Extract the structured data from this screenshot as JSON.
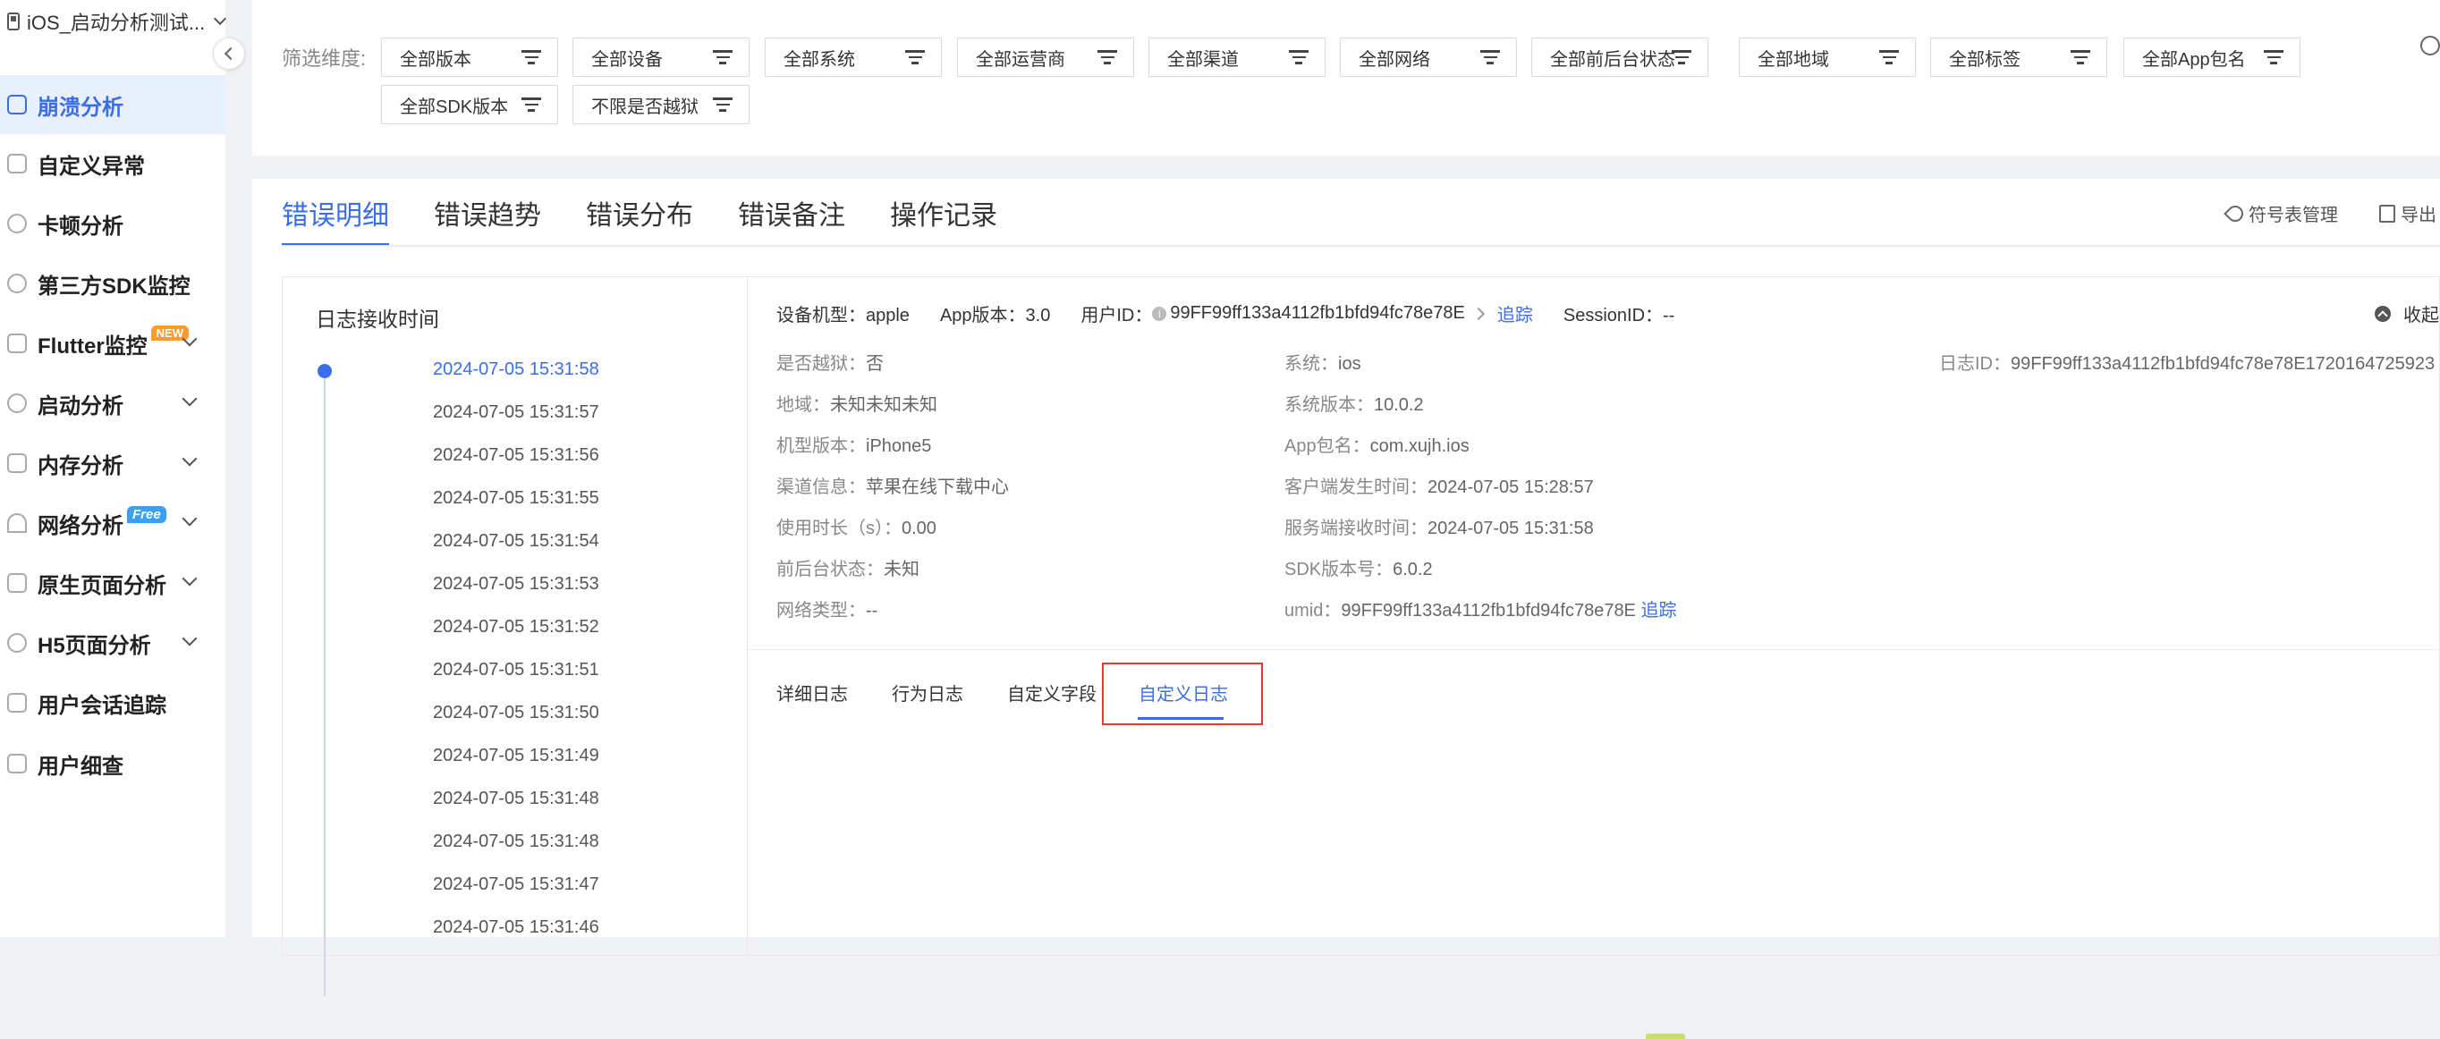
{
  "app": {
    "name": "iOS_启动分析测试..."
  },
  "sidebar": {
    "items": [
      {
        "label": "崩溃分析",
        "icon": "doc-icon"
      },
      {
        "label": "自定义异常",
        "icon": "chart-icon"
      },
      {
        "label": "卡顿分析",
        "icon": "clock-icon"
      },
      {
        "label": "第三方SDK监控",
        "icon": "user-icon"
      },
      {
        "label": "Flutter监控",
        "icon": "flutter-icon",
        "badge": "NEW"
      },
      {
        "label": "启动分析",
        "icon": "launch-icon"
      },
      {
        "label": "内存分析",
        "icon": "memory-icon"
      },
      {
        "label": "网络分析",
        "icon": "wifi-icon",
        "badge": "Free"
      },
      {
        "label": "原生页面分析",
        "icon": "page-icon"
      },
      {
        "label": "H5页面分析",
        "icon": "h5-icon"
      },
      {
        "label": "用户会话追踪",
        "icon": "session-icon"
      },
      {
        "label": "用户细查",
        "icon": "detail-icon"
      }
    ]
  },
  "filters": {
    "label": "筛选维度:",
    "items": [
      "全部版本",
      "全部设备",
      "全部系统",
      "全部运营商",
      "全部渠道",
      "全部网络",
      "全部前后台状态",
      "全部地域",
      "全部标签",
      "全部App包名",
      "全部SDK版本",
      "不限是否越狱"
    ]
  },
  "tabs": [
    "错误明细",
    "错误趋势",
    "错误分布",
    "错误备注",
    "操作记录"
  ],
  "tools": {
    "symbol": "符号表管理",
    "export": "导出"
  },
  "log_time": {
    "title": "日志接收时间",
    "times": [
      "2024-07-05 15:31:58",
      "2024-07-05 15:31:57",
      "2024-07-05 15:31:56",
      "2024-07-05 15:31:55",
      "2024-07-05 15:31:54",
      "2024-07-05 15:31:53",
      "2024-07-05 15:31:52",
      "2024-07-05 15:31:51",
      "2024-07-05 15:31:50",
      "2024-07-05 15:31:49",
      "2024-07-05 15:31:48",
      "2024-07-05 15:31:48",
      "2024-07-05 15:31:47",
      "2024-07-05 15:31:46"
    ]
  },
  "detail": {
    "device_model": "设备机型：apple",
    "app_version": "App版本：3.0",
    "user_id_label": "用户ID：",
    "user_id": "99FF99ff133a4112fb1bfd94fc78e78E",
    "track": "追踪",
    "session": "SessionID：--",
    "collapse": "收起",
    "fields": [
      {
        "k": "是否越狱：",
        "v": "否"
      },
      {
        "k": "系统：",
        "v": "ios"
      },
      {
        "k": "日志ID：",
        "v": "99FF99ff133a4112fb1bfd94fc78e78E1720164725923"
      },
      {
        "k": "地域：",
        "v": "未知未知未知"
      },
      {
        "k": "系统版本：",
        "v": "10.0.2"
      },
      {
        "k": "机型版本：",
        "v": "iPhone5"
      },
      {
        "k": "App包名：",
        "v": "com.xujh.ios"
      },
      {
        "k": "渠道信息：",
        "v": "苹果在线下载中心"
      },
      {
        "k": "客户端发生时间：",
        "v": "2024-07-05 15:28:57"
      },
      {
        "k": "使用时长（s）：",
        "v": "0.00"
      },
      {
        "k": "服务端接收时间：",
        "v": "2024-07-05 15:31:58"
      },
      {
        "k": "前后台状态：",
        "v": "未知"
      },
      {
        "k": "SDK版本号：",
        "v": "6.0.2"
      },
      {
        "k": "网络类型：",
        "v": "--"
      },
      {
        "k": "umid：",
        "v": "99FF99ff133a4112fb1bfd94fc78e78E"
      }
    ],
    "umid_track": "追踪",
    "subtabs": [
      "详细日志",
      "行为日志",
      "自定义字段",
      "自定义日志"
    ]
  },
  "colors": {
    "accent": "#3a6ee8",
    "highlight": "#e53935"
  }
}
